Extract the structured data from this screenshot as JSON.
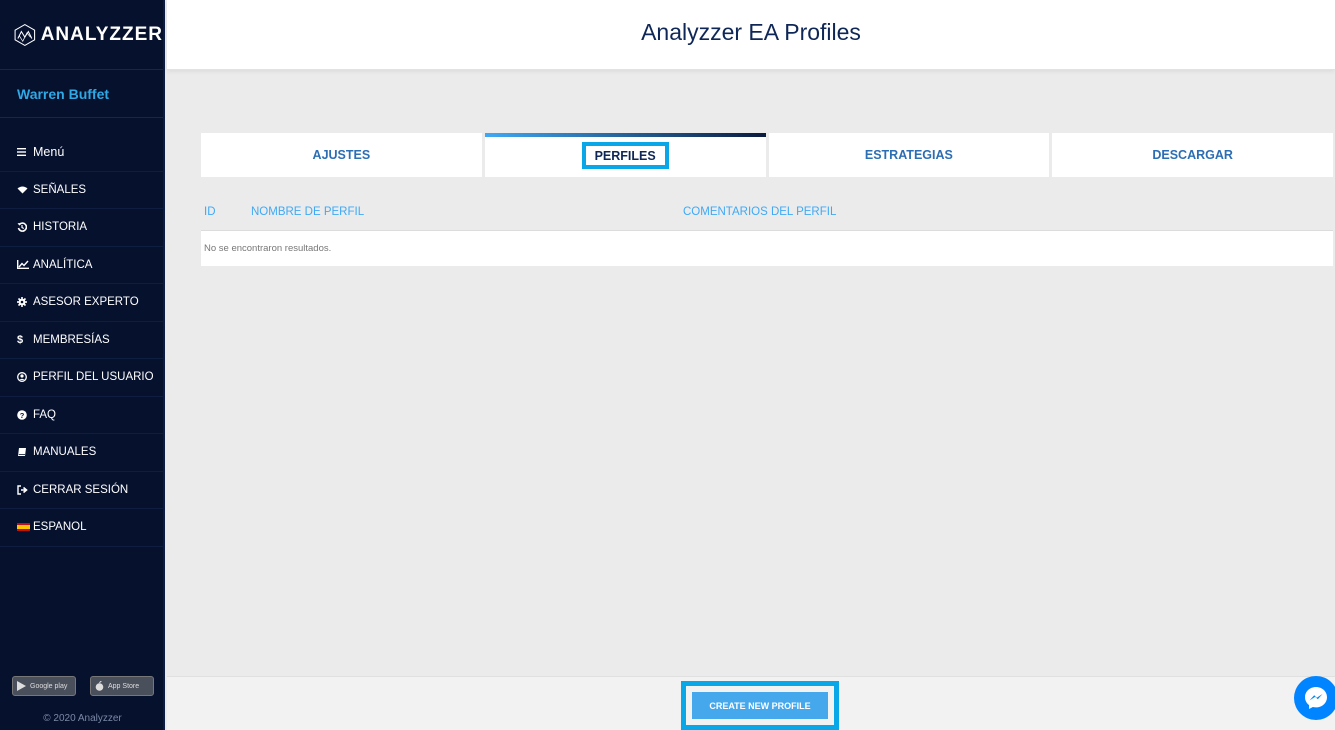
{
  "app": {
    "brand": "ANALYZZER"
  },
  "header": {
    "title": "Analyzzer EA Profiles"
  },
  "user": {
    "name": "Warren Buffet"
  },
  "sidebar": {
    "items": [
      {
        "label": "Menú",
        "icon": "hamburger-icon"
      },
      {
        "label": "SEÑALES",
        "icon": "signal-icon"
      },
      {
        "label": "HISTORIA",
        "icon": "history-icon"
      },
      {
        "label": "ANALÍTICA",
        "icon": "line-chart-icon"
      },
      {
        "label": "ASESOR EXPERTO",
        "icon": "gear-icon"
      },
      {
        "label": "MEMBRESÍAS",
        "icon": "dollar-icon"
      },
      {
        "label": "PERFIL DEL USUARIO",
        "icon": "user-circle-icon"
      },
      {
        "label": "FAQ",
        "icon": "question-icon"
      },
      {
        "label": "MANUALES",
        "icon": "book-icon"
      },
      {
        "label": "CERRAR SESIÓN",
        "icon": "sign-out-icon"
      },
      {
        "label": "ESPANOL",
        "icon": "spain-flag-icon"
      }
    ],
    "stores": {
      "google": "Google play",
      "apple": "App Store"
    },
    "copyright": "© 2020 Analyzzer"
  },
  "tabs": [
    {
      "label": "AJUSTES",
      "active": false
    },
    {
      "label": "PERFILES",
      "active": true
    },
    {
      "label": "ESTRATEGIAS",
      "active": false
    },
    {
      "label": "DESCARGAR",
      "active": false
    }
  ],
  "table": {
    "columns": [
      "ID",
      "NOMBRE DE PERFIL",
      "COMENTARIOS DEL PERFIL"
    ],
    "empty_message": "No se encontraron resultados."
  },
  "actions": {
    "create_label": "CREATE NEW PROFILE"
  },
  "colors": {
    "sidebar_bg": "#06112e",
    "accent": "#0aa7e8",
    "header_text": "#0f2756",
    "button": "#45a7ec"
  }
}
